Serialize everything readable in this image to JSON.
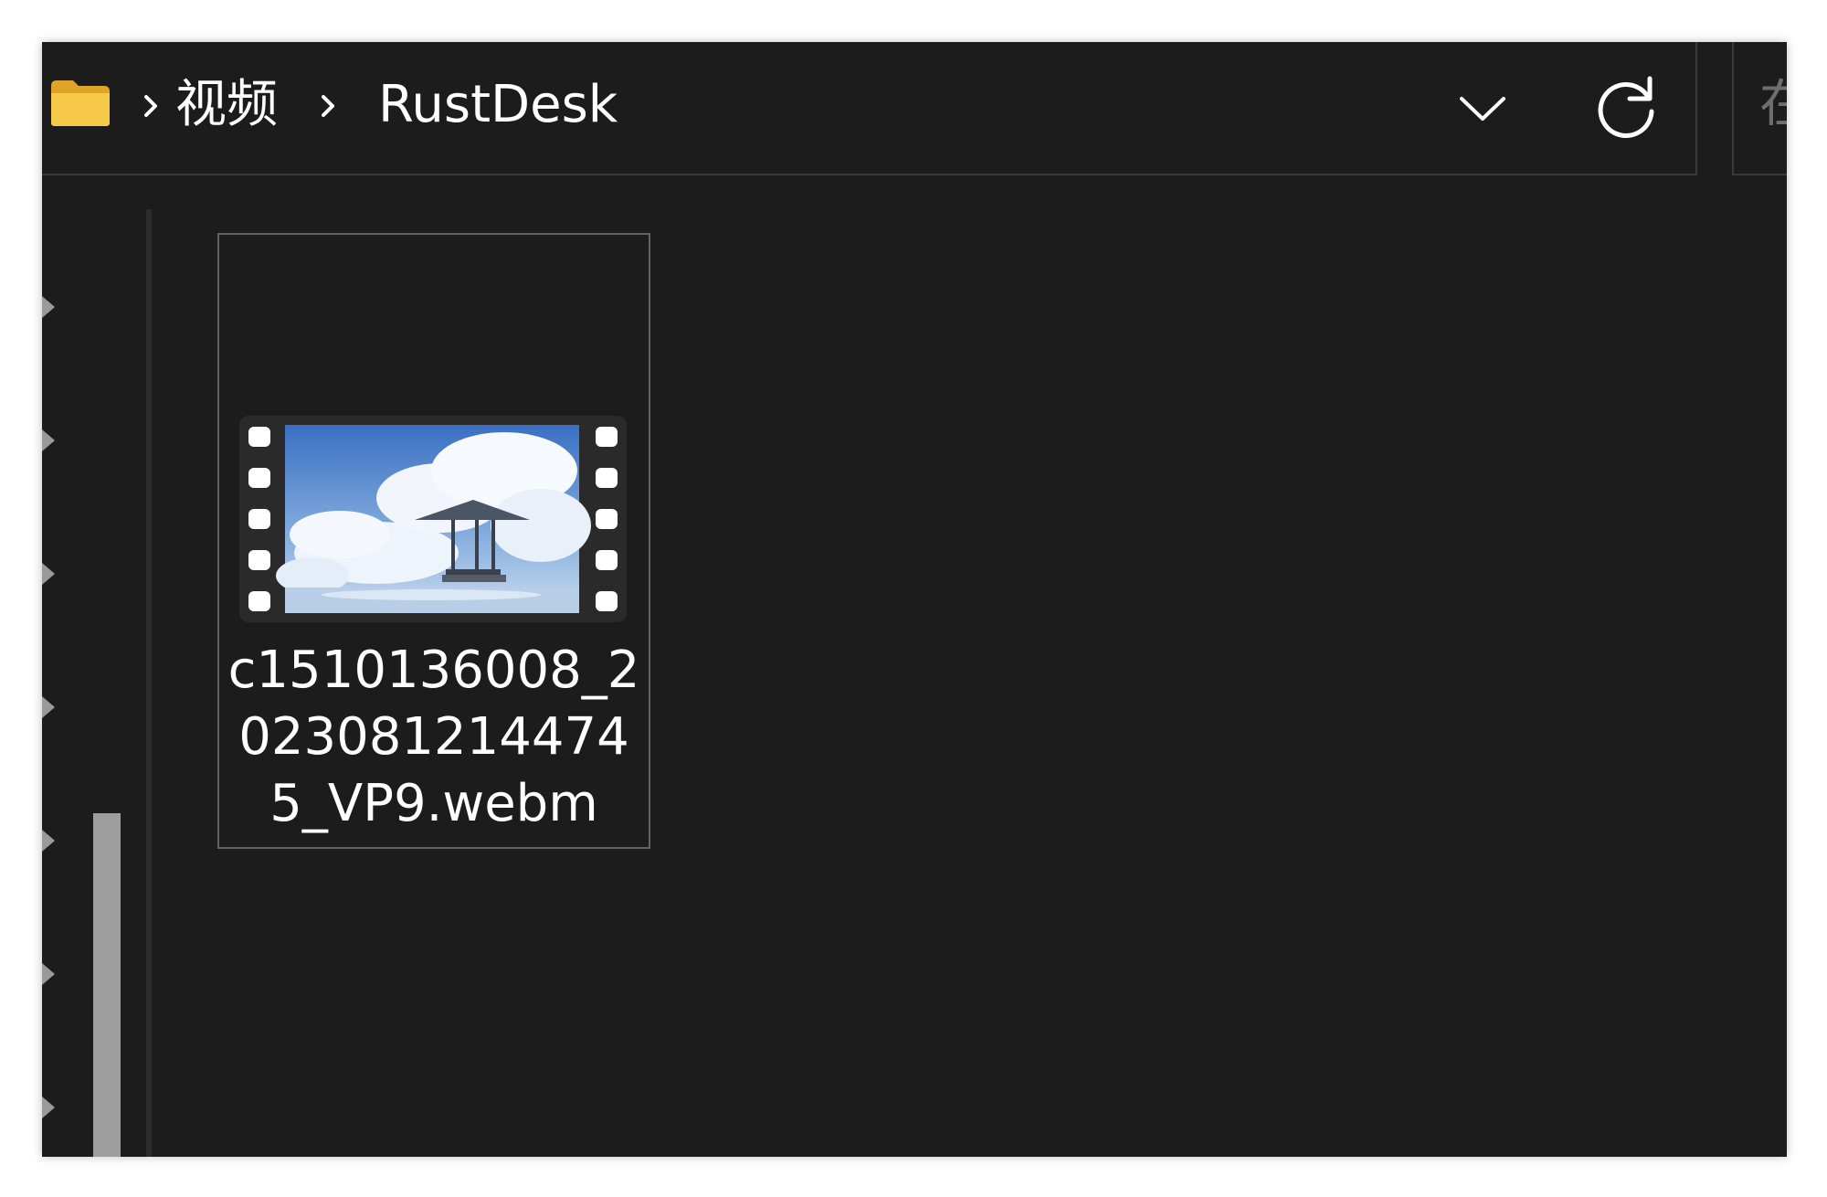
{
  "address_bar": {
    "breadcrumbs": [
      {
        "label": "视频"
      },
      {
        "label": "RustDesk"
      }
    ],
    "folder_icon": "folder-icon",
    "separator_icon": "chevron-right-icon",
    "dropdown_icon": "chevron-down-icon",
    "refresh_icon": "refresh-icon"
  },
  "search": {
    "placeholder_visible": "在"
  },
  "files": [
    {
      "name": "c1510136008_2023081214474 5_VP9.webm",
      "name_display": "c1510136008_2023081214474 5_VP9.webm",
      "icon": "video-thumbnail-icon"
    }
  ],
  "colors": {
    "window_bg": "#1c1c1c",
    "border": "#3a3a3a",
    "text": "#ffffff",
    "folder_yellow": "#f5c242",
    "scrollbar": "#9e9e9e"
  }
}
